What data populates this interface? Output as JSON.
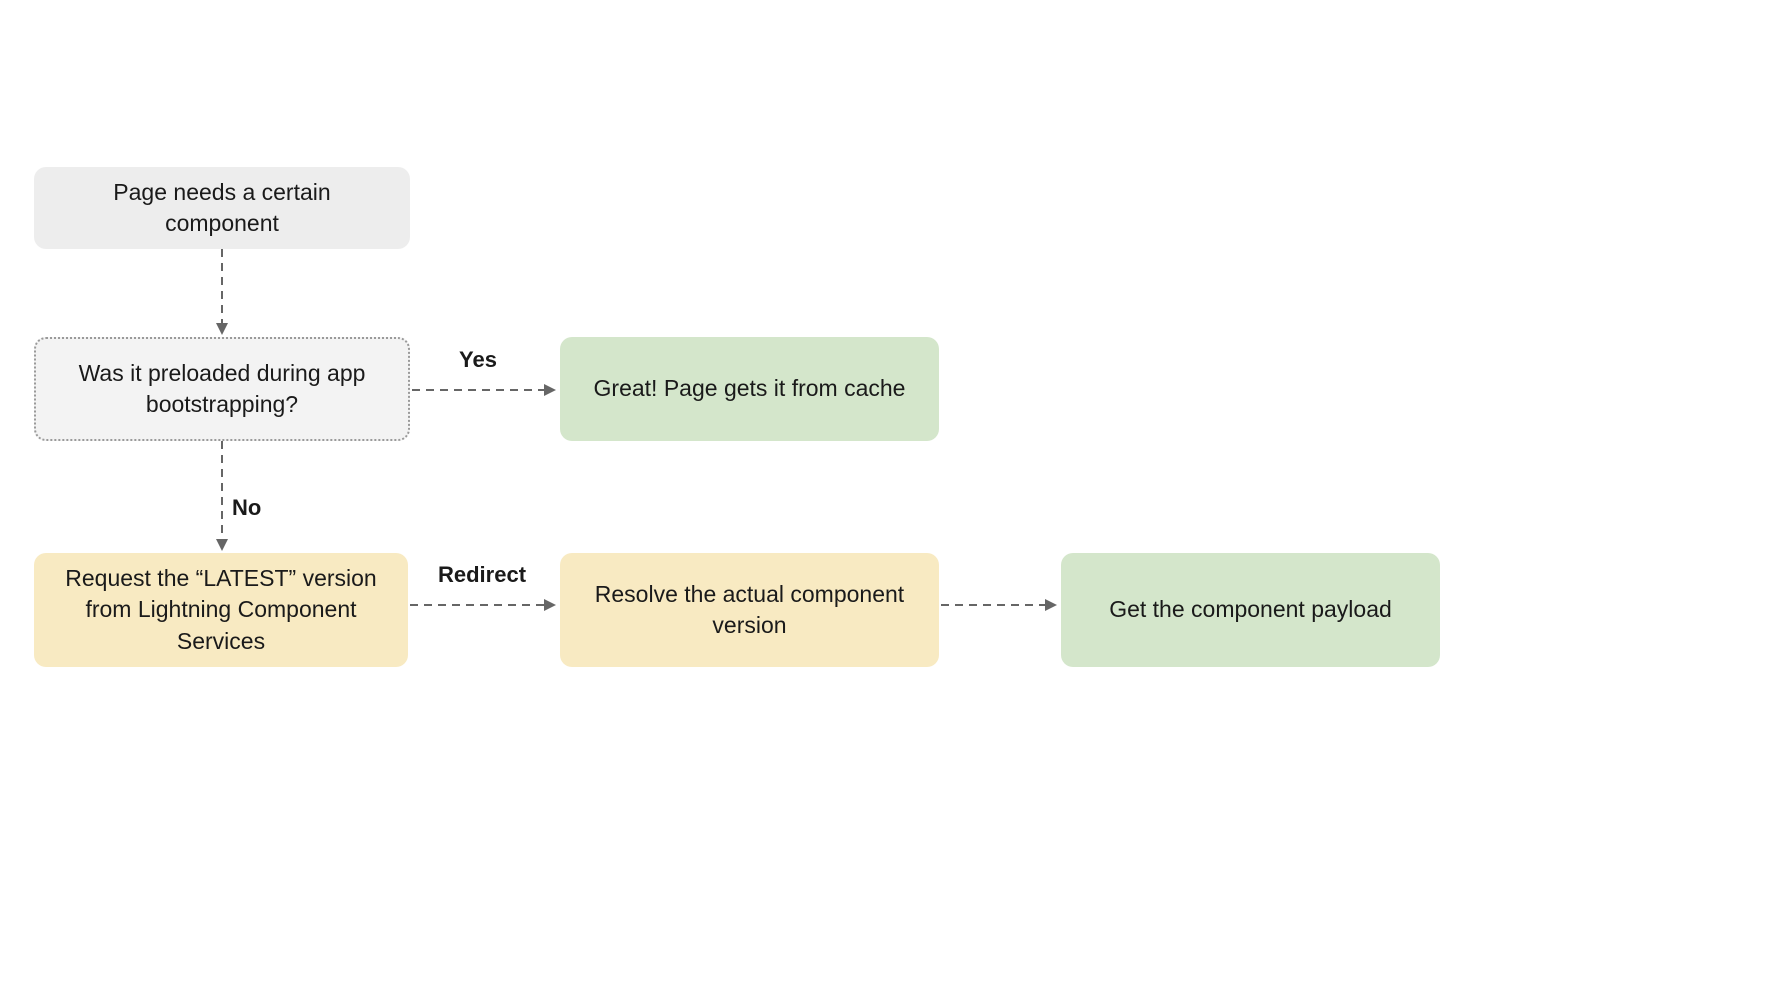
{
  "nodes": {
    "start": {
      "text": "Page needs a certain component"
    },
    "decision": {
      "text": "Was it preloaded during app bootstrapping?"
    },
    "cache": {
      "text": "Great! Page gets it from cache"
    },
    "request": {
      "text": "Request the “LATEST” version from Lightning Component Services"
    },
    "resolve": {
      "text": "Resolve the actual component version"
    },
    "payload": {
      "text": "Get the component payload"
    }
  },
  "edges": {
    "yes": {
      "label": "Yes"
    },
    "no": {
      "label": "No"
    },
    "redirect": {
      "label": "Redirect"
    }
  }
}
